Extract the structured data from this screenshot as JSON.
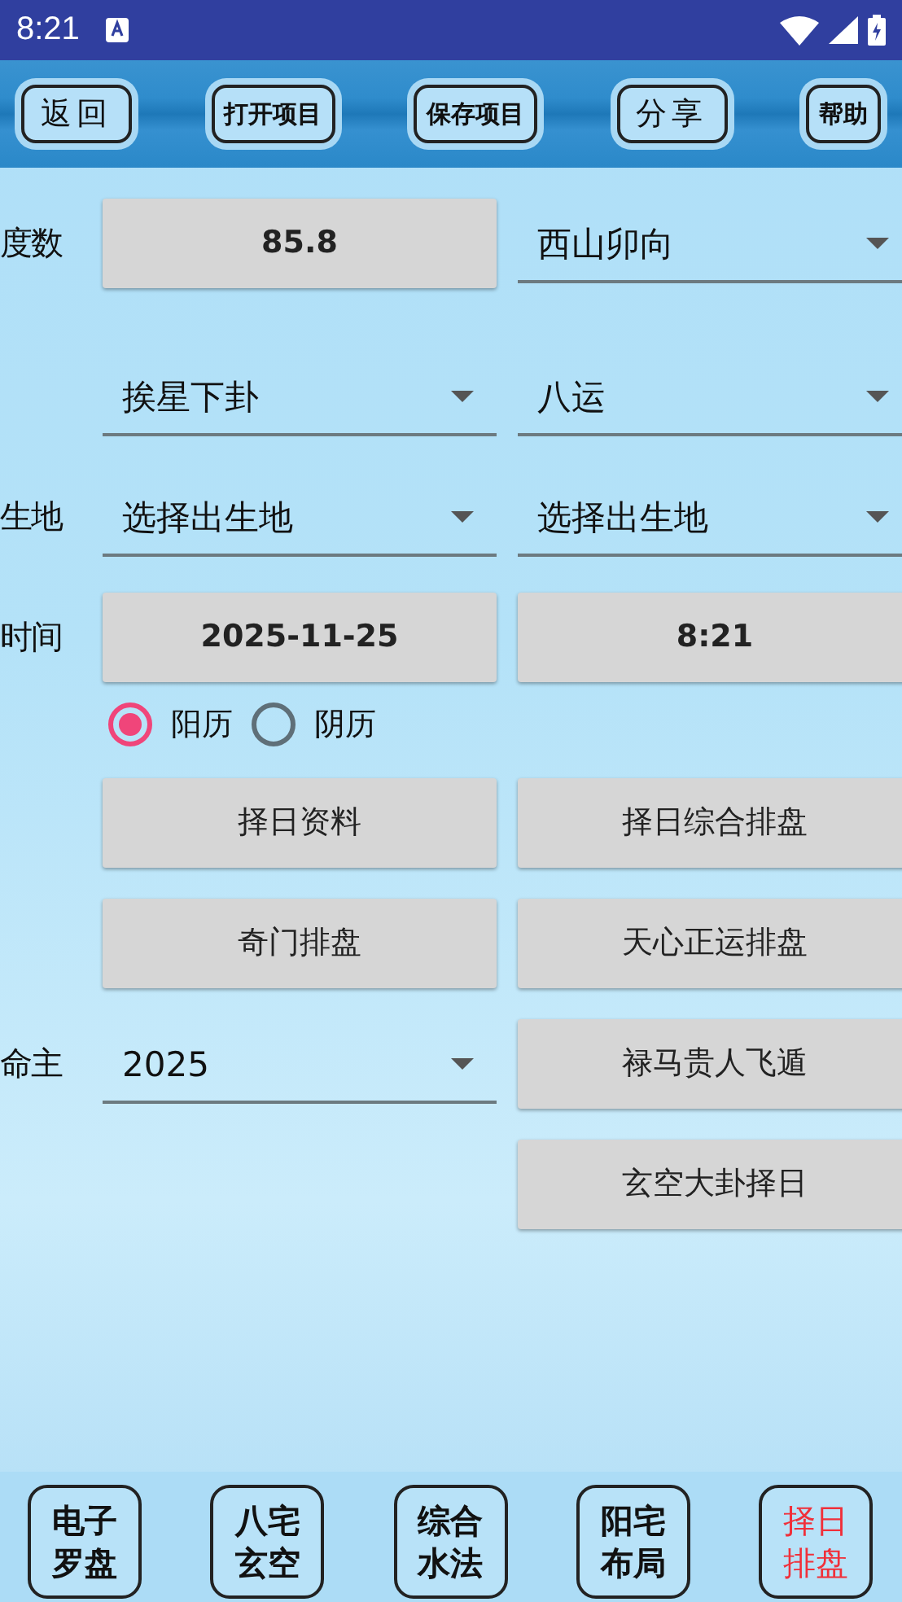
{
  "status_bar": {
    "time": "8:21"
  },
  "toolbar": [
    {
      "label": "返回"
    },
    {
      "label": "打开项目"
    },
    {
      "label": "保存项目"
    },
    {
      "label": "分享"
    },
    {
      "label": "帮助"
    }
  ],
  "rows": [
    {
      "label": "度数",
      "cells": [
        {
          "kind": "value",
          "text": "85.8"
        },
        {
          "kind": "dropdown",
          "text": "西山卯向"
        }
      ]
    },
    {
      "cells": [
        {
          "kind": "dropdown",
          "text": "挨星下卦"
        },
        {
          "kind": "dropdown",
          "text": "八运"
        }
      ]
    },
    {
      "label": "生地",
      "cells": [
        {
          "kind": "dropdown",
          "text": "选择出生地"
        },
        {
          "kind": "dropdown",
          "text": "选择出生地"
        }
      ]
    },
    {
      "label": "时间",
      "cells": [
        {
          "kind": "value",
          "text": "2025-11-25"
        },
        {
          "kind": "value",
          "text": "8:21"
        }
      ]
    },
    {
      "radios": [
        {
          "label": "阳历",
          "selected": true
        },
        {
          "label": "阴历",
          "selected": false
        }
      ]
    },
    {
      "cells": [
        {
          "kind": "button",
          "text": "择日资料"
        },
        {
          "kind": "button",
          "text": "择日综合排盘"
        }
      ]
    },
    {
      "cells": [
        {
          "kind": "button",
          "text": "奇门排盘"
        },
        {
          "kind": "button",
          "text": "天心正运排盘"
        }
      ]
    },
    {
      "label": "命主",
      "cells": [
        {
          "kind": "dropdown",
          "text": "2025"
        },
        {
          "kind": "button",
          "text": "禄马贵人飞遁"
        }
      ]
    },
    {
      "cells": [
        {
          "kind": "empty"
        },
        {
          "kind": "button",
          "text": "玄空大卦择日"
        }
      ]
    }
  ],
  "bottom_nav": [
    {
      "label": "电子罗盘",
      "selected": false
    },
    {
      "label": "八宅玄空",
      "selected": false
    },
    {
      "label": "综合水法",
      "selected": false
    },
    {
      "label": "阳宅布局",
      "selected": false
    },
    {
      "label": "择日排盘",
      "selected": true
    }
  ]
}
